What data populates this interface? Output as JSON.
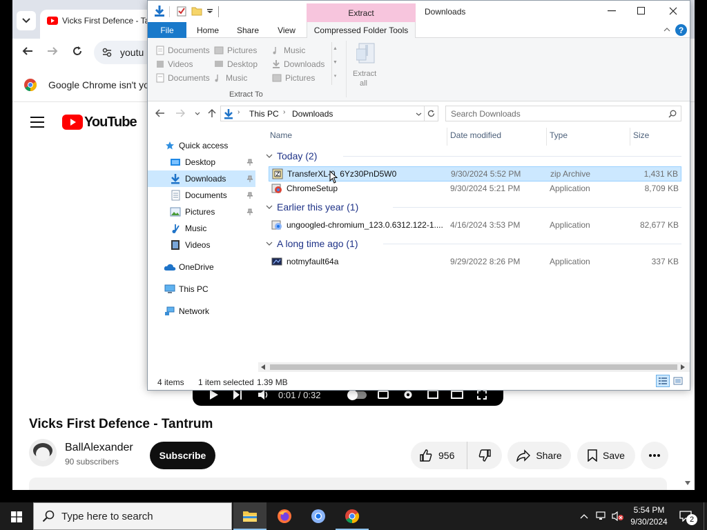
{
  "chrome": {
    "tab_title": "Vicks First Defence - Tantrum",
    "address_partial": "youtu",
    "info_bar_text": "Google Chrome isn't yo",
    "youtube_logo_text": "YouTube"
  },
  "video": {
    "time": "0:01 / 0:32",
    "title": "Vicks First Defence - Tantrum",
    "channel": "BallAlexander",
    "subscribers": "90 subscribers",
    "subscribe_label": "Subscribe",
    "likes": "956",
    "share_label": "Share",
    "save_label": "Save"
  },
  "explorer": {
    "context_tab": "Extract",
    "window_title": "Downloads",
    "tabs": {
      "file": "File",
      "home": "Home",
      "share": "Share",
      "view": "View",
      "tools": "Compressed Folder Tools"
    },
    "ribbon": {
      "col1": [
        "Documents",
        "Videos",
        "Documents"
      ],
      "col2": [
        "Pictures",
        "Desktop",
        "Music"
      ],
      "col3": [
        "Music",
        "Downloads",
        "Pictures"
      ],
      "extract_to": "Extract To",
      "extract_all_1": "Extract",
      "extract_all_2": "all"
    },
    "address": {
      "this_pc": "This PC",
      "downloads": "Downloads",
      "search_placeholder": "Search Downloads"
    },
    "nav": {
      "quick_access": "Quick access",
      "desktop": "Desktop",
      "downloads": "Downloads",
      "documents": "Documents",
      "pictures": "Pictures",
      "music": "Music",
      "videos": "Videos",
      "onedrive": "OneDrive",
      "this_pc": "This PC",
      "network": "Network"
    },
    "columns": {
      "name": "Name",
      "date": "Date modified",
      "type": "Type",
      "size": "Size"
    },
    "groups": [
      {
        "label": "Today (2)"
      },
      {
        "label": "Earlier this year (1)"
      },
      {
        "label": "A long time ago (1)"
      }
    ],
    "files": [
      {
        "name": "TransferXL-0 6Yz30PnD5W0",
        "date": "9/30/2024 5:52 PM",
        "type": "zip Archive",
        "size": "1,431 KB"
      },
      {
        "name": "ChromeSetup",
        "date": "9/30/2024 5:21 PM",
        "type": "Application",
        "size": "8,709 KB"
      },
      {
        "name": "ungoogled-chromium_123.0.6312.122-1....",
        "date": "4/16/2024 3:53 PM",
        "type": "Application",
        "size": "82,677 KB"
      },
      {
        "name": "notmyfault64a",
        "date": "9/29/2022 8:26 PM",
        "type": "Application",
        "size": "337 KB"
      }
    ],
    "status": {
      "items": "4 items",
      "selected": "1 item selected",
      "size": "1.39 MB"
    }
  },
  "taskbar": {
    "search_placeholder": "Type here to search",
    "time": "5:54 PM",
    "date": "9/30/2024",
    "notification_count": "2"
  },
  "colors": {
    "selection": "#cce8ff",
    "extract_context": "#f7c5dd",
    "file_tab": "#1979ca",
    "group_heading": "#1e3287",
    "youtube_red": "#ff0000"
  }
}
